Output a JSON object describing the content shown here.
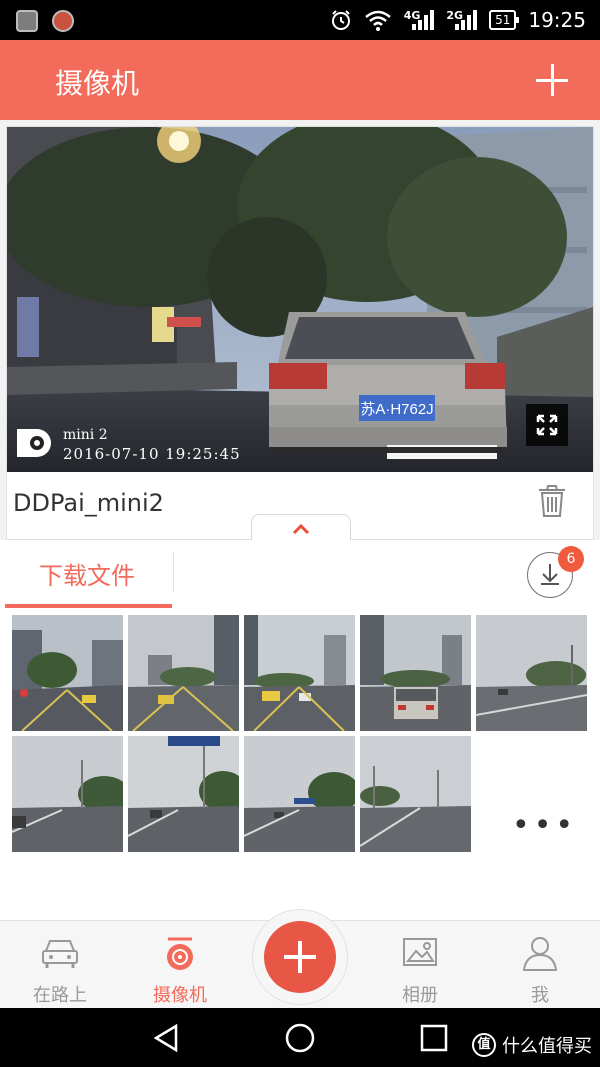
{
  "status_bar": {
    "time": "19:25",
    "battery": "51",
    "network_1": "4G",
    "network_2": "2G",
    "icons": [
      "gallery-notification-icon",
      "app-notification-icon",
      "alarm-icon",
      "wifi-icon",
      "signal-icon",
      "battery-icon"
    ]
  },
  "header": {
    "title": "摄像机",
    "add_icon": "plus-icon"
  },
  "camera": {
    "device_name": "DDPai_mini2",
    "model_overlay": "mini 2",
    "timestamp_overlay": "2016-07-10  19:25:45",
    "plate_text": "苏A·H762J",
    "fullscreen_icon": "fullscreen-icon",
    "delete_icon": "trash-icon",
    "expand_icon": "chevron-up-icon"
  },
  "downloads": {
    "tab_label": "下载文件",
    "badge_count": "6",
    "download_icon": "download-icon",
    "thumbnails_count": 9,
    "more_label": "•••"
  },
  "bottom_nav": {
    "items": [
      {
        "label": "在路上",
        "icon": "car-icon",
        "active": false
      },
      {
        "label": "摄像机",
        "icon": "camera-icon",
        "active": true
      },
      {
        "label": "",
        "icon": "plus-icon",
        "active": false
      },
      {
        "label": "相册",
        "icon": "gallery-icon",
        "active": false
      },
      {
        "label": "我",
        "icon": "user-icon",
        "active": false
      }
    ]
  },
  "watermark": {
    "logo": "值",
    "text": "什么值得买"
  },
  "colors": {
    "accent": "#f26b5b",
    "fab": "#e85746",
    "badge": "#f05a3e"
  }
}
